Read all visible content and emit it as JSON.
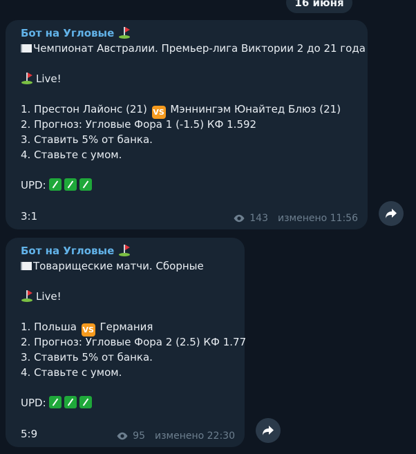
{
  "date_label": "16 июня",
  "messages": [
    {
      "sender": "Бот на Угловые",
      "league": "Чемпионат Австралии. Премьер-лига Виктории 2 до 21 года",
      "live": "Live!",
      "line1_a": "1. Престон Лайонс (21)",
      "line1_b": "Мэннингэм Юнайтед Блюз (21)",
      "line2": "2. Прогноз: Угловые Фора 1 (-1.5) КФ 1.592",
      "line3": "3. Ставить 5% от банка.",
      "line4": "4. Ставьте с умом.",
      "upd": "UPD:",
      "score": "3:1",
      "views": "143",
      "edited": "изменено 11:56"
    },
    {
      "sender": "Бот на Угловые",
      "league": "Товарищеские матчи. Сборные",
      "live": "Live!",
      "line1_a": "1. Польша",
      "line1_b": "Германия",
      "line2": "2. Прогноз: Угловые Фора 2 (2.5) КФ 1.77",
      "line3": "3. Ставить 5% от банка.",
      "line4": "4. Ставьте с умом.",
      "upd": "UPD:",
      "score": "5:9",
      "views": "95",
      "edited": "изменено 22:30"
    }
  ],
  "icons": {
    "vs": "VS",
    "flag": "white-flag-icon",
    "golf": "golf-flag-icon",
    "check": "check-mark-icon",
    "eye": "eye-icon",
    "forward": "forward-arrow-icon"
  },
  "colors": {
    "background": "#0e1621",
    "bubble": "#182533",
    "sender": "#62b3e9",
    "meta": "#6d7f8f"
  }
}
